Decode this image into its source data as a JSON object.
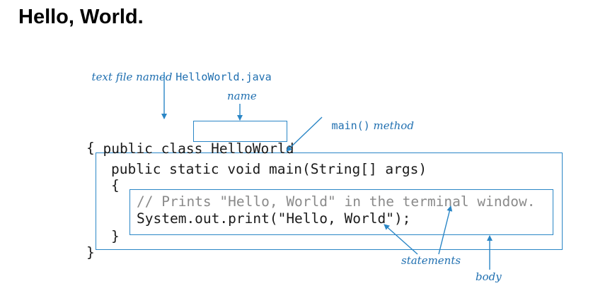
{
  "page": {
    "title": "Hello, World."
  },
  "annotations": {
    "file_prefix": "text file named ",
    "file_name": "HelloWorld.java",
    "name": "name",
    "main_method_mono": "main()",
    "main_method_text": " method",
    "statements": "statements",
    "body": "body"
  },
  "code": {
    "class_decl": "public class ",
    "class_name": "HelloWorld",
    "open_class": "{",
    "method_decl": "public static void main(String[] args)",
    "open_method": "{",
    "comment": "// Prints \"Hello, World\" in the terminal window.",
    "print_stmt": "System.out.print(\"Hello, World\");",
    "close_method": "}",
    "close_class": "}"
  },
  "colors": {
    "annotation": "#1f6fb0",
    "box": "#2a86c6",
    "comment": "#8a8a8a"
  }
}
